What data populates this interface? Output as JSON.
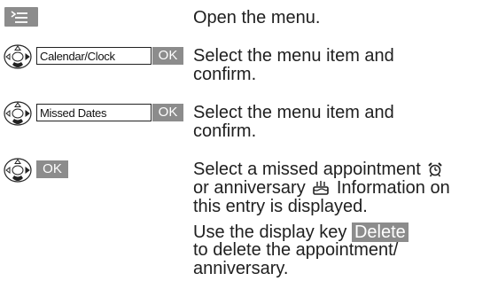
{
  "steps": [
    {
      "key_icon": "menu-key-icon",
      "description": "Open the menu."
    },
    {
      "key_icon": "navigation-key-icon",
      "menu_item": "Calendar/Clock",
      "ok_label": "OK",
      "description_line1": "Select the menu item and",
      "description_line2": "confirm."
    },
    {
      "key_icon": "navigation-key-icon",
      "menu_item": "Missed Dates",
      "ok_label": "OK",
      "description_line1": "Select the menu item and",
      "description_line2": "confirm."
    },
    {
      "key_icon": "navigation-key-icon",
      "ok_label": "OK",
      "description_line1_pre": "Select a missed appointment",
      "appointment_icon": "alarm-clock-icon",
      "description_line2_pre": "or anniversary",
      "anniversary_icon": "cake-icon",
      "description_line2_post": "Information on",
      "description_line3": "this entry is displayed."
    },
    {
      "line1_pre": "Use the display key",
      "display_key_label": "Delete",
      "line2": "to delete the appointment/",
      "line3": "anniversary."
    }
  ],
  "colors": {
    "key_background": "#8c8c8c",
    "key_text": "#ffffff",
    "body_text": "#202020"
  }
}
